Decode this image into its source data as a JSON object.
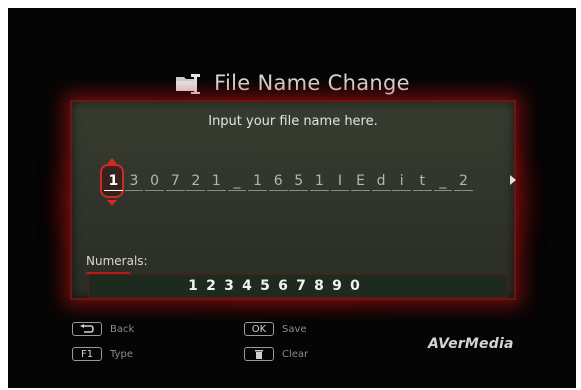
{
  "dialog": {
    "title": "File Name Change",
    "title_icon": "folder-rename-icon",
    "prompt": "Input your file name here."
  },
  "filename": {
    "chars": [
      "1",
      "3",
      "0",
      "7",
      "2",
      "1",
      "_",
      "1",
      "6",
      "5",
      "1",
      "I",
      "E",
      "d",
      "i",
      "t",
      "_",
      "2"
    ],
    "cursor_index": 0,
    "more_indicator": "right-arrow-icon"
  },
  "input_mode": {
    "label": "Numerals:",
    "keys": [
      "1",
      "2",
      "3",
      "4",
      "5",
      "6",
      "7",
      "8",
      "9",
      "0"
    ]
  },
  "legend": {
    "back": {
      "key": "⮌",
      "label": "Back",
      "icon": "return-icon"
    },
    "type": {
      "key": "F1",
      "label": "Type"
    },
    "save": {
      "key": "OK",
      "label": "Save"
    },
    "clear": {
      "key": "🗑",
      "label": "Clear",
      "icon": "trash-icon"
    }
  },
  "brand": "AVerMedia",
  "colors": {
    "accent_red": "#d12a22",
    "panel_bg": "#373c30",
    "screen_bg": "#050505"
  }
}
